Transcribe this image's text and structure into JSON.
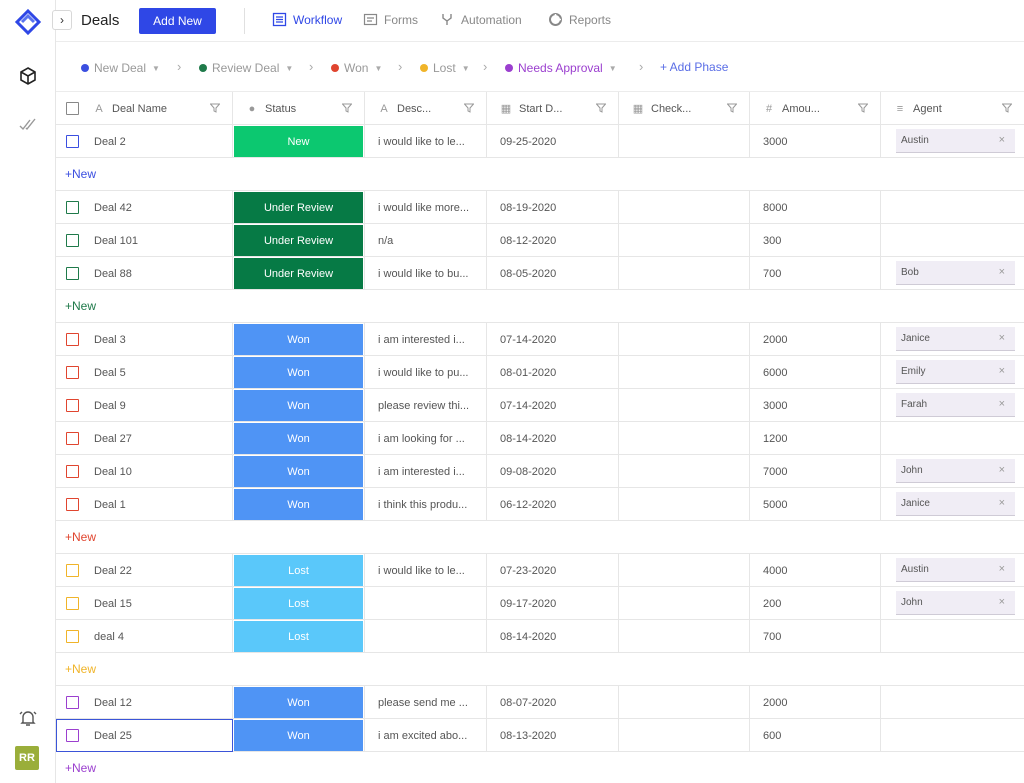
{
  "app": {
    "title": "Deals",
    "add_new_label": "Add New",
    "user_initials": "RR",
    "brand_color": "#2f47e6"
  },
  "tabs": [
    {
      "label": "Workflow",
      "icon": "grid-icon",
      "active": true
    },
    {
      "label": "Forms",
      "icon": "form-icon",
      "active": false
    },
    {
      "label": "Automation",
      "icon": "branch-icon",
      "active": false
    },
    {
      "label": "Reports",
      "icon": "pie-icon",
      "active": false
    }
  ],
  "phases": [
    {
      "label": "New Deal",
      "color": "#3b4fe0"
    },
    {
      "label": "Review Deal",
      "color": "#1f7a4a"
    },
    {
      "label": "Won",
      "color": "#e0452f"
    },
    {
      "label": "Lost",
      "color": "#f0b429"
    },
    {
      "label": "Needs Approval",
      "color": "#9b3fcf"
    }
  ],
  "add_phase_label": "+ Add Phase",
  "columns": [
    {
      "label": "Deal Name",
      "icon": "text-icon"
    },
    {
      "label": "Status",
      "icon": "status-icon"
    },
    {
      "label": "Desc...",
      "icon": "text-icon"
    },
    {
      "label": "Start D...",
      "icon": "calendar-icon"
    },
    {
      "label": "Check...",
      "icon": "checklist-icon"
    },
    {
      "label": "Amou...",
      "icon": "hash-icon"
    },
    {
      "label": "Agent",
      "icon": "list-icon"
    }
  ],
  "new_label": "+New",
  "groups": [
    {
      "color": "#3b4fe0",
      "rows": [
        {
          "name": "Deal 2",
          "status": "New",
          "status_color": "#0cc870",
          "desc": "i would like to le...",
          "date": "09-25-2020",
          "amount": "3000",
          "agent": "Austin"
        }
      ]
    },
    {
      "color": "#1f7a4a",
      "rows": [
        {
          "name": "Deal 42",
          "status": "Under Review",
          "status_color": "#067a45",
          "desc": "i would like more...",
          "date": "08-19-2020",
          "amount": "8000",
          "agent": ""
        },
        {
          "name": "Deal 101",
          "status": "Under Review",
          "status_color": "#067a45",
          "desc": "n/a",
          "date": "08-12-2020",
          "amount": "300",
          "agent": ""
        },
        {
          "name": "Deal 88",
          "status": "Under Review",
          "status_color": "#067a45",
          "desc": "i would like to bu...",
          "date": "08-05-2020",
          "amount": "700",
          "agent": "Bob"
        }
      ]
    },
    {
      "color": "#e0452f",
      "rows": [
        {
          "name": "Deal 3",
          "status": "Won",
          "status_color": "#4f94f5",
          "desc": "i am interested i...",
          "date": "07-14-2020",
          "amount": "2000",
          "agent": "Janice"
        },
        {
          "name": "Deal 5",
          "status": "Won",
          "status_color": "#4f94f5",
          "desc": "i would like to pu...",
          "date": "08-01-2020",
          "amount": "6000",
          "agent": "Emily"
        },
        {
          "name": "Deal 9",
          "status": "Won",
          "status_color": "#4f94f5",
          "desc": "please review thi...",
          "date": "07-14-2020",
          "amount": "3000",
          "agent": "Farah"
        },
        {
          "name": "Deal 27",
          "status": "Won",
          "status_color": "#4f94f5",
          "desc": "i am looking for ...",
          "date": "08-14-2020",
          "amount": "1200",
          "agent": ""
        },
        {
          "name": "Deal 10",
          "status": "Won",
          "status_color": "#4f94f5",
          "desc": "i am interested i...",
          "date": "09-08-2020",
          "amount": "7000",
          "agent": "John"
        },
        {
          "name": "Deal 1",
          "status": "Won",
          "status_color": "#4f94f5",
          "desc": "i think this produ...",
          "date": "06-12-2020",
          "amount": "5000",
          "agent": "Janice"
        }
      ]
    },
    {
      "color": "#f0b429",
      "rows": [
        {
          "name": "Deal 22",
          "status": "Lost",
          "status_color": "#5ac8fa",
          "desc": "i would like to le...",
          "date": "07-23-2020",
          "amount": "4000",
          "agent": "Austin"
        },
        {
          "name": "Deal 15",
          "status": "Lost",
          "status_color": "#5ac8fa",
          "desc": "",
          "date": "09-17-2020",
          "amount": "200",
          "agent": "John"
        },
        {
          "name": "deal 4",
          "status": "Lost",
          "status_color": "#5ac8fa",
          "desc": "",
          "date": "08-14-2020",
          "amount": "700",
          "agent": ""
        }
      ]
    },
    {
      "color": "#9b3fcf",
      "rows": [
        {
          "name": "Deal 12",
          "status": "Won",
          "status_color": "#4f94f5",
          "desc": "please send me ...",
          "date": "08-07-2020",
          "amount": "2000",
          "agent": ""
        },
        {
          "name": "Deal 25",
          "status": "Won",
          "status_color": "#4f94f5",
          "desc": "i am excited abo...",
          "date": "08-13-2020",
          "amount": "600",
          "agent": "",
          "selected": true
        }
      ]
    }
  ]
}
